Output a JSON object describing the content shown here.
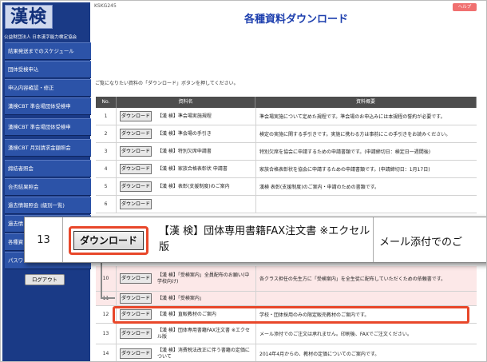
{
  "app": {
    "logo": "漢検",
    "org_name": "公益財団法人 日本漢字能力検定協会",
    "screen_id": "KSKG245",
    "help_label": "ヘルプ",
    "page_title": "各種資料ダウンロード",
    "instruction": "ご覧になりたい資料の「ダウンロード」ボタンを押してください。"
  },
  "sidebar": {
    "items": [
      {
        "label": "結果発送までのスケジュール"
      },
      {
        "label": "団体受検申込"
      },
      {
        "label": "申込内容確認・修正"
      },
      {
        "label": "漢検CBT 準会場団体受検申"
      },
      {
        "label": "漢検CBT 準会場団体受検申"
      },
      {
        "label": "漢検CBT 月別請求金額照会"
      },
      {
        "label": "締結者照会"
      },
      {
        "label": "合否結果照会"
      },
      {
        "label": "過去情報照会 (級別一覧)"
      },
      {
        "label": "過去情"
      },
      {
        "label": "各種資"
      },
      {
        "label": "パスワ"
      }
    ],
    "logout_label": "ログアウト"
  },
  "table": {
    "headers": {
      "no": "No.",
      "name": "資料名",
      "desc": "資料概要"
    },
    "download_label": "ダウンロード",
    "rows": [
      {
        "no": "1",
        "name": "【漢 検】準会場実施規程",
        "desc": "準会場実施について定めた規程です。準会場のお申込みには本規程の誓約が必要です。"
      },
      {
        "no": "2",
        "name": "【漢 検】準会場の手引き",
        "desc": "検定の実施に関する手引きです。実施に携わる方は事前にこの手引きをお読みください。"
      },
      {
        "no": "3",
        "name": "【漢 検】特別欠席申請書",
        "desc": "特別欠席を協会に申請するための申請書類です。(申請締切日：検定日一週間後)"
      },
      {
        "no": "4",
        "name": "【漢 検】家族合格表彰状 申請書",
        "desc": "家族合格表彰状を協会に申請するための申請書類です。(申請締切日：1月17日)"
      },
      {
        "no": "5",
        "name": "【漢 検】表彰(支援制度)のご案内",
        "desc": "漢検 表彰(支援制度)のご案内・申請のための書類です。"
      },
      {
        "no": "6",
        "name": "",
        "desc": ""
      },
      {
        "no": "10",
        "name": "【漢 検】「受検案内」全員配布のお願い(中学校向け)",
        "desc": "各クラス担任の先生方に「受検案内」を全生徒に配布していただくための依頼書です。"
      },
      {
        "no": "11",
        "name": "【漢 検】「受検案内」",
        "desc": ""
      },
      {
        "no": "12",
        "name": "【漢 検】直販教材のご案内",
        "desc": "学校・団体採用のみの限定販売教材のご案内です。"
      },
      {
        "no": "13",
        "name": "【漢 検】団体専用書籍FAX注文書 ※エクセル版",
        "desc": "メール添付でのご注文は承れません。印刷後、FAXでご注文ください。"
      },
      {
        "no": "14",
        "name": "【漢 検】消費税法改正に伴う書籍の定価について",
        "desc": "2014年4月からの、教材の定価についてのご案内です。"
      }
    ]
  },
  "zoom": {
    "no": "13",
    "name": "【漢 検】団体専用書籍FAX注文書 ※エクセル版",
    "desc": "メール添付でのご"
  }
}
